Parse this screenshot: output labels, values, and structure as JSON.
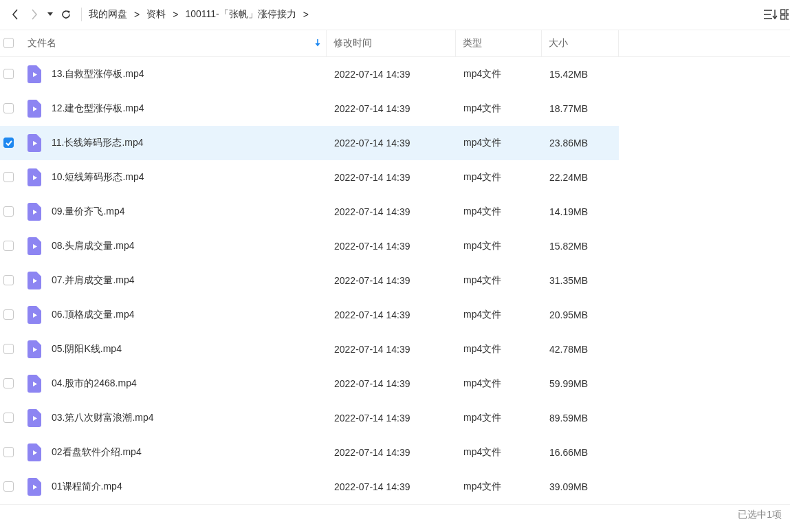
{
  "breadcrumb": [
    {
      "label": "我的网盘",
      "separator": ">"
    },
    {
      "label": "资料",
      "separator": ">"
    },
    {
      "label": "100111-「张帆」涨停接力",
      "separator": ">"
    }
  ],
  "table": {
    "select_all": {
      "checked": false
    },
    "columns": [
      {
        "label": "文件名",
        "sorted": true
      },
      {
        "label": "修改时间",
        "sorted": false
      },
      {
        "label": "类型",
        "sorted": false
      },
      {
        "label": "大小",
        "sorted": false
      }
    ],
    "rows": [
      {
        "name": "13.自救型涨停板.mp4",
        "modified": "2022-07-14 14:39",
        "type": "mp4文件",
        "size": "15.42MB",
        "selected": false
      },
      {
        "name": "12.建仓型涨停板.mp4",
        "modified": "2022-07-14 14:39",
        "type": "mp4文件",
        "size": "18.77MB",
        "selected": false
      },
      {
        "name": "11.长线筹码形态.mp4",
        "modified": "2022-07-14 14:39",
        "type": "mp4文件",
        "size": "23.86MB",
        "selected": true
      },
      {
        "name": "10.短线筹码形态.mp4",
        "modified": "2022-07-14 14:39",
        "type": "mp4文件",
        "size": "22.24MB",
        "selected": false
      },
      {
        "name": "09.量价齐飞.mp4",
        "modified": "2022-07-14 14:39",
        "type": "mp4文件",
        "size": "14.19MB",
        "selected": false
      },
      {
        "name": "08.头肩成交量.mp4",
        "modified": "2022-07-14 14:39",
        "type": "mp4文件",
        "size": "15.82MB",
        "selected": false
      },
      {
        "name": "07.并肩成交量.mp4",
        "modified": "2022-07-14 14:39",
        "type": "mp4文件",
        "size": "31.35MB",
        "selected": false
      },
      {
        "name": "06.顶格成交量.mp4",
        "modified": "2022-07-14 14:39",
        "type": "mp4文件",
        "size": "20.95MB",
        "selected": false
      },
      {
        "name": "05.阴阳K线.mp4",
        "modified": "2022-07-14 14:39",
        "type": "mp4文件",
        "size": "42.78MB",
        "selected": false
      },
      {
        "name": "04.股市的2468.mp4",
        "modified": "2022-07-14 14:39",
        "type": "mp4文件",
        "size": "59.99MB",
        "selected": false
      },
      {
        "name": "03.第八次财富浪潮.mp4",
        "modified": "2022-07-14 14:39",
        "type": "mp4文件",
        "size": "89.59MB",
        "selected": false
      },
      {
        "name": "02看盘软件介绍.mp4",
        "modified": "2022-07-14 14:39",
        "type": "mp4文件",
        "size": "16.66MB",
        "selected": false
      },
      {
        "name": "01课程简介.mp4",
        "modified": "2022-07-14 14:39",
        "type": "mp4文件",
        "size": "39.09MB",
        "selected": false
      }
    ]
  },
  "status_bar": "已选中1项"
}
